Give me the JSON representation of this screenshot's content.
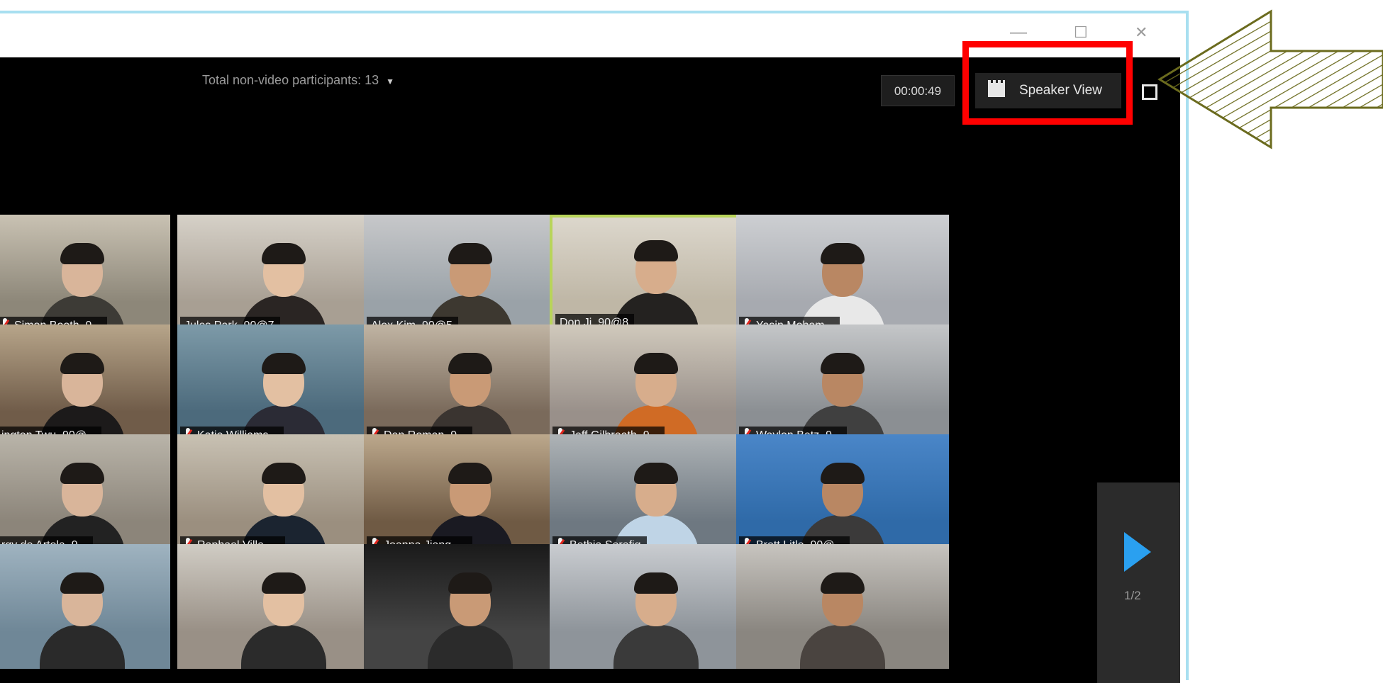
{
  "window": {
    "minimize_glyph": "—",
    "maximize_glyph": "☐",
    "close_glyph": "✕"
  },
  "toolbar": {
    "participants_text": "Total non-video participants: 13",
    "timer": "00:00:49",
    "speaker_view_label": "Speaker View"
  },
  "grid": {
    "participants": [
      {
        "name": "Simon Booth, 9...",
        "muted": true
      },
      {
        "name": "Jules Park, 90@7",
        "muted": false
      },
      {
        "name": "Alex Kim, 90@5",
        "muted": false
      },
      {
        "name": "Don Ji, 90@8",
        "muted": false,
        "active": true
      },
      {
        "name": "Yasin Moham...",
        "muted": true
      },
      {
        "name": "ington Twu, 90@...",
        "muted": false
      },
      {
        "name": "Katie Williams...",
        "muted": true
      },
      {
        "name": "Dan Roman, 9...",
        "muted": true
      },
      {
        "name": "Jeff Gilbreath, 9...",
        "muted": true
      },
      {
        "name": "Waylon Betz, 9...",
        "muted": true
      },
      {
        "name": "rgy de Artola, 9...",
        "muted": false
      },
      {
        "name": "Raphael Villa, ...",
        "muted": true
      },
      {
        "name": "Joanna Jiang, ...",
        "muted": true
      },
      {
        "name": "Bethia Serafig",
        "muted": true
      },
      {
        "name": "Brett Litle, 90@...",
        "muted": true
      },
      {
        "name": "",
        "muted": false
      },
      {
        "name": "",
        "muted": false
      },
      {
        "name": "",
        "muted": false
      },
      {
        "name": "",
        "muted": false
      },
      {
        "name": "",
        "muted": false
      }
    ]
  },
  "pagination": {
    "page_indicator": "1/2"
  },
  "colors": {
    "frame_border": "#a8dff0",
    "highlight_box": "#ff0000",
    "active_speaker_border": "#b8d45a",
    "next_arrow": "#2aa0f0",
    "annotation_arrow": "#6b6b1e"
  }
}
